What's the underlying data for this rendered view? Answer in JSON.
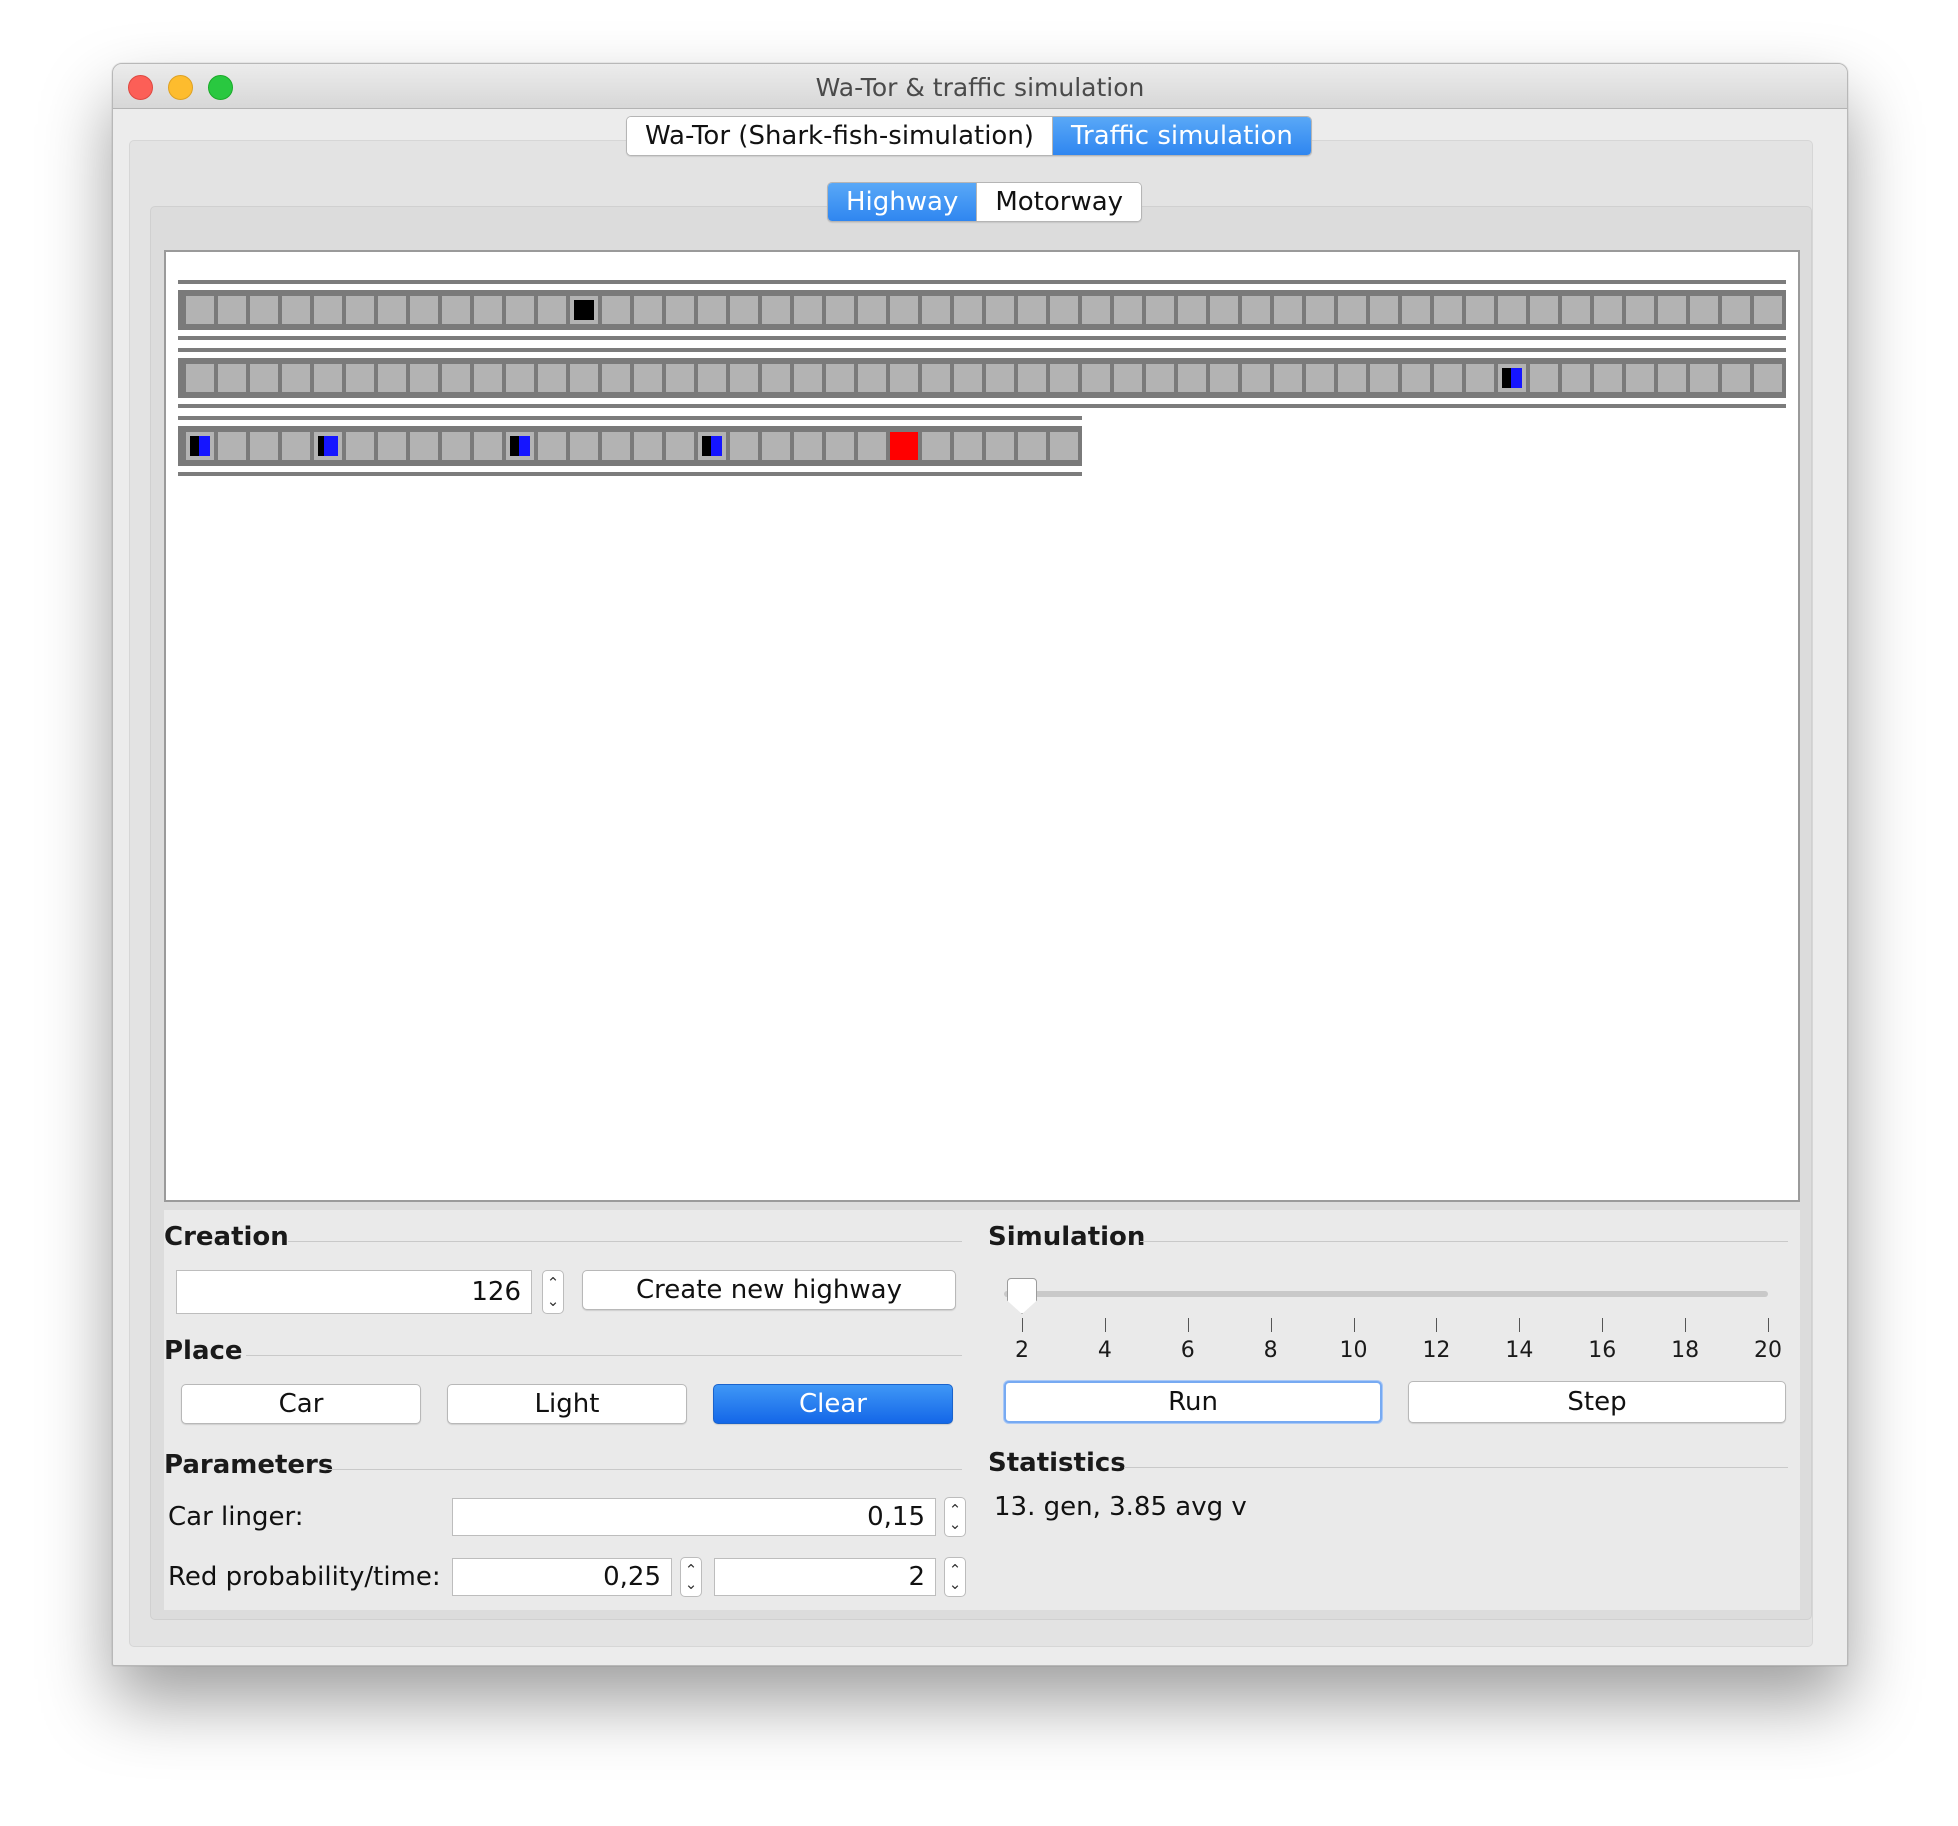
{
  "window": {
    "title": "Wa-Tor & traffic simulation"
  },
  "top_tabs": [
    {
      "label": "Wa-Tor (Shark-fish-simulation)",
      "active": false
    },
    {
      "label": "Traffic simulation",
      "active": true
    }
  ],
  "sub_tabs": [
    {
      "label": "Highway",
      "active": true
    },
    {
      "label": "Motorway",
      "active": false
    }
  ],
  "simulation_view": {
    "roads": [
      {
        "cells": 50,
        "cars": [
          {
            "cell": 12,
            "kind": "stopped"
          }
        ],
        "lights": []
      },
      {
        "cells": 50,
        "cars": [
          {
            "cell": 41,
            "kind": "moving"
          }
        ],
        "lights": []
      },
      {
        "cells": 28,
        "cars": [
          {
            "cell": 0,
            "kind": "moving"
          },
          {
            "cell": 4,
            "kind": "fast"
          },
          {
            "cell": 10,
            "kind": "moving"
          },
          {
            "cell": 16,
            "kind": "moving"
          }
        ],
        "lights": [
          22
        ]
      }
    ],
    "colors": {
      "road": "#7a7a7a",
      "cell": "#b3b3b3",
      "car": "#000000",
      "car_motion": "#1515ff",
      "light_red": "#ff0000"
    }
  },
  "creation": {
    "title": "Creation",
    "highway_length": "126",
    "create_button": "Create new highway"
  },
  "place": {
    "title": "Place",
    "car_button": "Car",
    "light_button": "Light",
    "clear_button": "Clear"
  },
  "parameters": {
    "title": "Parameters",
    "car_linger_label": "Car linger:",
    "car_linger_value": "0,15",
    "red_label": "Red probability/time:",
    "red_probability_value": "0,25",
    "red_time_value": "2"
  },
  "simulation": {
    "title": "Simulation",
    "speed_value": 2,
    "speed_ticks": [
      "2",
      "4",
      "6",
      "8",
      "10",
      "12",
      "14",
      "16",
      "18",
      "20"
    ],
    "run_button": "Run",
    "step_button": "Step"
  },
  "statistics": {
    "title": "Statistics",
    "text": "13. gen, 3.85 avg v"
  }
}
